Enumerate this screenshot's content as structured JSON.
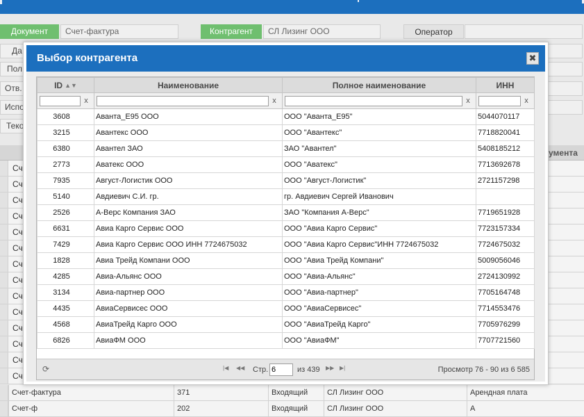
{
  "form": {
    "document_label": "Документ",
    "document_value": "Счет-фактура",
    "counterparty_label": "Контрагент",
    "counterparty_value": "СЛ Лизинг ООО",
    "operator_label": "Оператор",
    "operator_value": "",
    "stubs": [
      "Да",
      "Пол",
      "Отв.",
      "Испо",
      "Теко"
    ]
  },
  "background_grid": {
    "header_right": "ументa",
    "row_stub": "Сч",
    "bottom_row": {
      "doc": "Счет-фактура",
      "num": "371",
      "type": "Входящий",
      "counterparty": "СЛ Лизинг ООО",
      "purpose": "Арендная плата"
    },
    "cut_row": {
      "doc": "Счет-ф",
      "num": "202",
      "type": "Входящий",
      "counterparty": "СЛ Лизинг ООО",
      "purpose": "А"
    }
  },
  "modal": {
    "title": "Выбор контрагента",
    "close_glyph": "✖",
    "columns": [
      "ID",
      "Наименование",
      "Полное наименование",
      "ИНН"
    ],
    "filter_clear": "x",
    "rows": [
      {
        "id": "3608",
        "name": "Аванта_Е95 ООО",
        "full_name": "ООО \"Аванта_Е95\"",
        "inn": "5044070117"
      },
      {
        "id": "3215",
        "name": "Авантекс ООО",
        "full_name": "ООО \"Авантекс\"",
        "inn": "7718820041"
      },
      {
        "id": "6380",
        "name": "Авантел ЗАО",
        "full_name": "ЗАО \"Авантел\"",
        "inn": "5408185212"
      },
      {
        "id": "2773",
        "name": "Аватекс ООО",
        "full_name": "ООО \"Аватекс\"",
        "inn": "7713692678"
      },
      {
        "id": "7935",
        "name": "Август-Логистик ООО",
        "full_name": "ООО \"Август-Логистик\"",
        "inn": "2721157298"
      },
      {
        "id": "5140",
        "name": "Авдиевич С.И. гр.",
        "full_name": "гр. Авдиевич Сергей Иванович",
        "inn": ""
      },
      {
        "id": "2526",
        "name": "А-Верс Компания ЗАО",
        "full_name": "ЗАО \"Компания А-Верс\"",
        "inn": "7719651928"
      },
      {
        "id": "6631",
        "name": "Авиа Карго Сервис ООО",
        "full_name": "ООО \"Авиа Карго Сервис\"",
        "inn": "7723157334"
      },
      {
        "id": "7429",
        "name": "Авиа Карго Сервис ООО ИНН 7724675032",
        "full_name": "ООО \"Авиа Карго Сервис\"ИНН 7724675032",
        "inn": "7724675032"
      },
      {
        "id": "1828",
        "name": "Авиа Трейд Компани ООО",
        "full_name": "ООО \"Авиа Трейд Компани\"",
        "inn": "5009056046"
      },
      {
        "id": "4285",
        "name": "Авиа-Альянс ООО",
        "full_name": "ООО \"Авиа-Альянс\"",
        "inn": "2724130992"
      },
      {
        "id": "3134",
        "name": "Авиа-партнер ООО",
        "full_name": "ООО \"Авиа-партнер\"",
        "inn": "7705164748"
      },
      {
        "id": "4435",
        "name": "АвиаСервисес ООО",
        "full_name": "ООО \"АвиаСервисес\"",
        "inn": "7714553476"
      },
      {
        "id": "4568",
        "name": "АвиаТрейд Карго ООО",
        "full_name": "ООО \"АвиаТрейд Карго\"",
        "inn": "7705976299"
      },
      {
        "id": "6826",
        "name": "АвиаФМ ООО",
        "full_name": "ООО \"АвиаФМ\"",
        "inn": "7707721560"
      }
    ],
    "pager": {
      "page_label": "Стр.",
      "page_value": "6",
      "of_label": "из 439",
      "view_text": "Просмотр 76 - 90 из 6 585"
    }
  }
}
